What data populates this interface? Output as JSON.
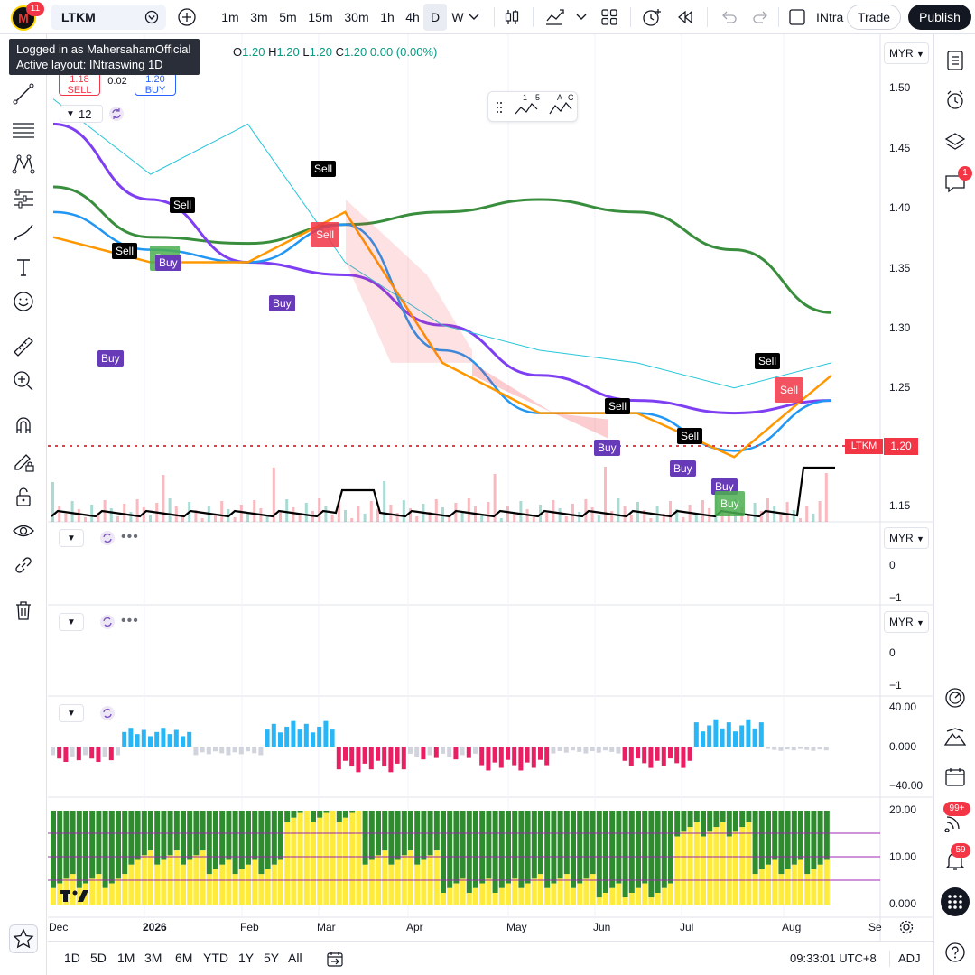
{
  "topbar": {
    "avatar_letter": "M",
    "avatar_badge": "11",
    "symbol": "LTKM",
    "timeframes": [
      "1m",
      "3m",
      "5m",
      "15m",
      "30m",
      "1h",
      "4h",
      "D",
      "W"
    ],
    "active_timeframe": "D",
    "layout_name": "INtra",
    "trade_label": "Trade",
    "publish_label": "Publish"
  },
  "tooltip": {
    "line1": "Logged in as MahersahamOfficial",
    "line2": "Active layout: INtraswing 1D"
  },
  "legend": {
    "o_label": "O",
    "o_val": "1.20",
    "h_label": "H",
    "h_val": "1.20",
    "l_label": "L",
    "l_val": "1.20",
    "c_label": "C",
    "c_val": "1.20",
    "change": "0.00 (0.00%)",
    "sell_price": "1.18",
    "sell_label": "SELL",
    "spread": "0.02",
    "buy_price": "1.20",
    "buy_label": "BUY",
    "indicator_count": "12"
  },
  "pattern_labels": {
    "p1": "1",
    "p2": "5",
    "p3": "A",
    "p4": "C"
  },
  "currency": "MYR",
  "main_price_axis": [
    "1.50",
    "1.45",
    "1.40",
    "1.35",
    "1.30",
    "1.25",
    "1.20",
    "1.15"
  ],
  "last_price": {
    "symbol": "LTKM",
    "value": "1.20"
  },
  "pane2_axis": [
    "0",
    "−1"
  ],
  "pane3_axis": [
    "0",
    "−1"
  ],
  "pane4_axis": [
    "40.00",
    "0.000",
    "−40.00"
  ],
  "pane5_axis": [
    "20.00",
    "10.00",
    "0.000"
  ],
  "time_axis": [
    "Dec",
    "2026",
    "Feb",
    "Mar",
    "Apr",
    "May",
    "Jun",
    "Jul",
    "Aug",
    "Se"
  ],
  "signals": {
    "sell": "Sell",
    "buy": "Buy"
  },
  "bottombar": {
    "ranges": [
      "1D",
      "5D",
      "1M",
      "3M",
      "6M",
      "YTD",
      "1Y",
      "5Y",
      "All"
    ],
    "clock": "09:33:01 UTC+8",
    "adj": "ADJ"
  },
  "right_badges": {
    "chat": "1",
    "ideas": "99+",
    "alerts": "59"
  },
  "chart_data": [
    {
      "type": "line",
      "title": "LTKM",
      "note": "Daily price chart with moving averages and bands",
      "x": [
        "Dec",
        "2026",
        "Feb",
        "Mar",
        "Apr",
        "May",
        "Jun",
        "Jul",
        "Aug"
      ],
      "ylim": [
        1.14,
        1.51
      ],
      "series": [
        {
          "name": "",
          "values": [
            1.39,
            1.35,
            1.345,
            1.36,
            1.37,
            1.38,
            1.37,
            1.34,
            1.29
          ]
        },
        {
          "name": "",
          "values": [
            1.44,
            1.38,
            1.33,
            1.32,
            1.28,
            1.24,
            1.22,
            1.21,
            1.22
          ]
        },
        {
          "name": "",
          "values": [
            1.37,
            1.34,
            1.33,
            1.36,
            1.26,
            1.21,
            1.21,
            1.18,
            1.22
          ]
        }
      ],
      "last": 1.2
    },
    {
      "type": "bar",
      "note": "Histogram oscillator",
      "ylim": [
        -40,
        40
      ],
      "values": [
        -18,
        22,
        -10,
        30,
        -30,
        -15,
        -28,
        -8,
        -25,
        32,
        -5
      ]
    },
    {
      "type": "area",
      "ylim": [
        0,
        20
      ],
      "note": "Stacked area pane",
      "values": [
        5,
        10,
        8,
        19,
        10,
        4,
        5,
        3,
        16,
        8
      ]
    }
  ]
}
